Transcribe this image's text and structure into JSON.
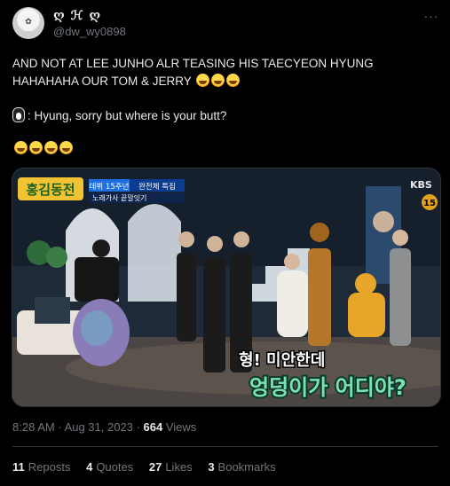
{
  "user": {
    "display_name": "ღ ℋ ღ",
    "handle": "@dw_wy0898",
    "more_menu": "···"
  },
  "tweet": {
    "line1": "AND NOT AT LEE JUNHO ALR TEASING HIS TAECYEON HYUNG HAHAHAHA OUR TOM & JERRY",
    "line2": ": Hyung, sorry but where is your butt?"
  },
  "media": {
    "show_logo": "홍김동전",
    "banner_badge": "데뷔 15주년",
    "banner_text": "완전체 특집",
    "banner_sub": "노래가사 끝말잇기",
    "broadcaster": "KBS",
    "rating": "15",
    "subtitle_line1": "형! 미안한데",
    "subtitle_line2": "엉덩이가 어디야?"
  },
  "meta": {
    "time": "8:28 AM",
    "date": "Aug 31, 2023",
    "views": "664",
    "views_label": "Views"
  },
  "stats": {
    "reposts_num": "11",
    "reposts_label": "Reposts",
    "quotes_num": "4",
    "quotes_label": "Quotes",
    "likes_num": "27",
    "likes_label": "Likes",
    "bookmarks_num": "3",
    "bookmarks_label": "Bookmarks"
  }
}
